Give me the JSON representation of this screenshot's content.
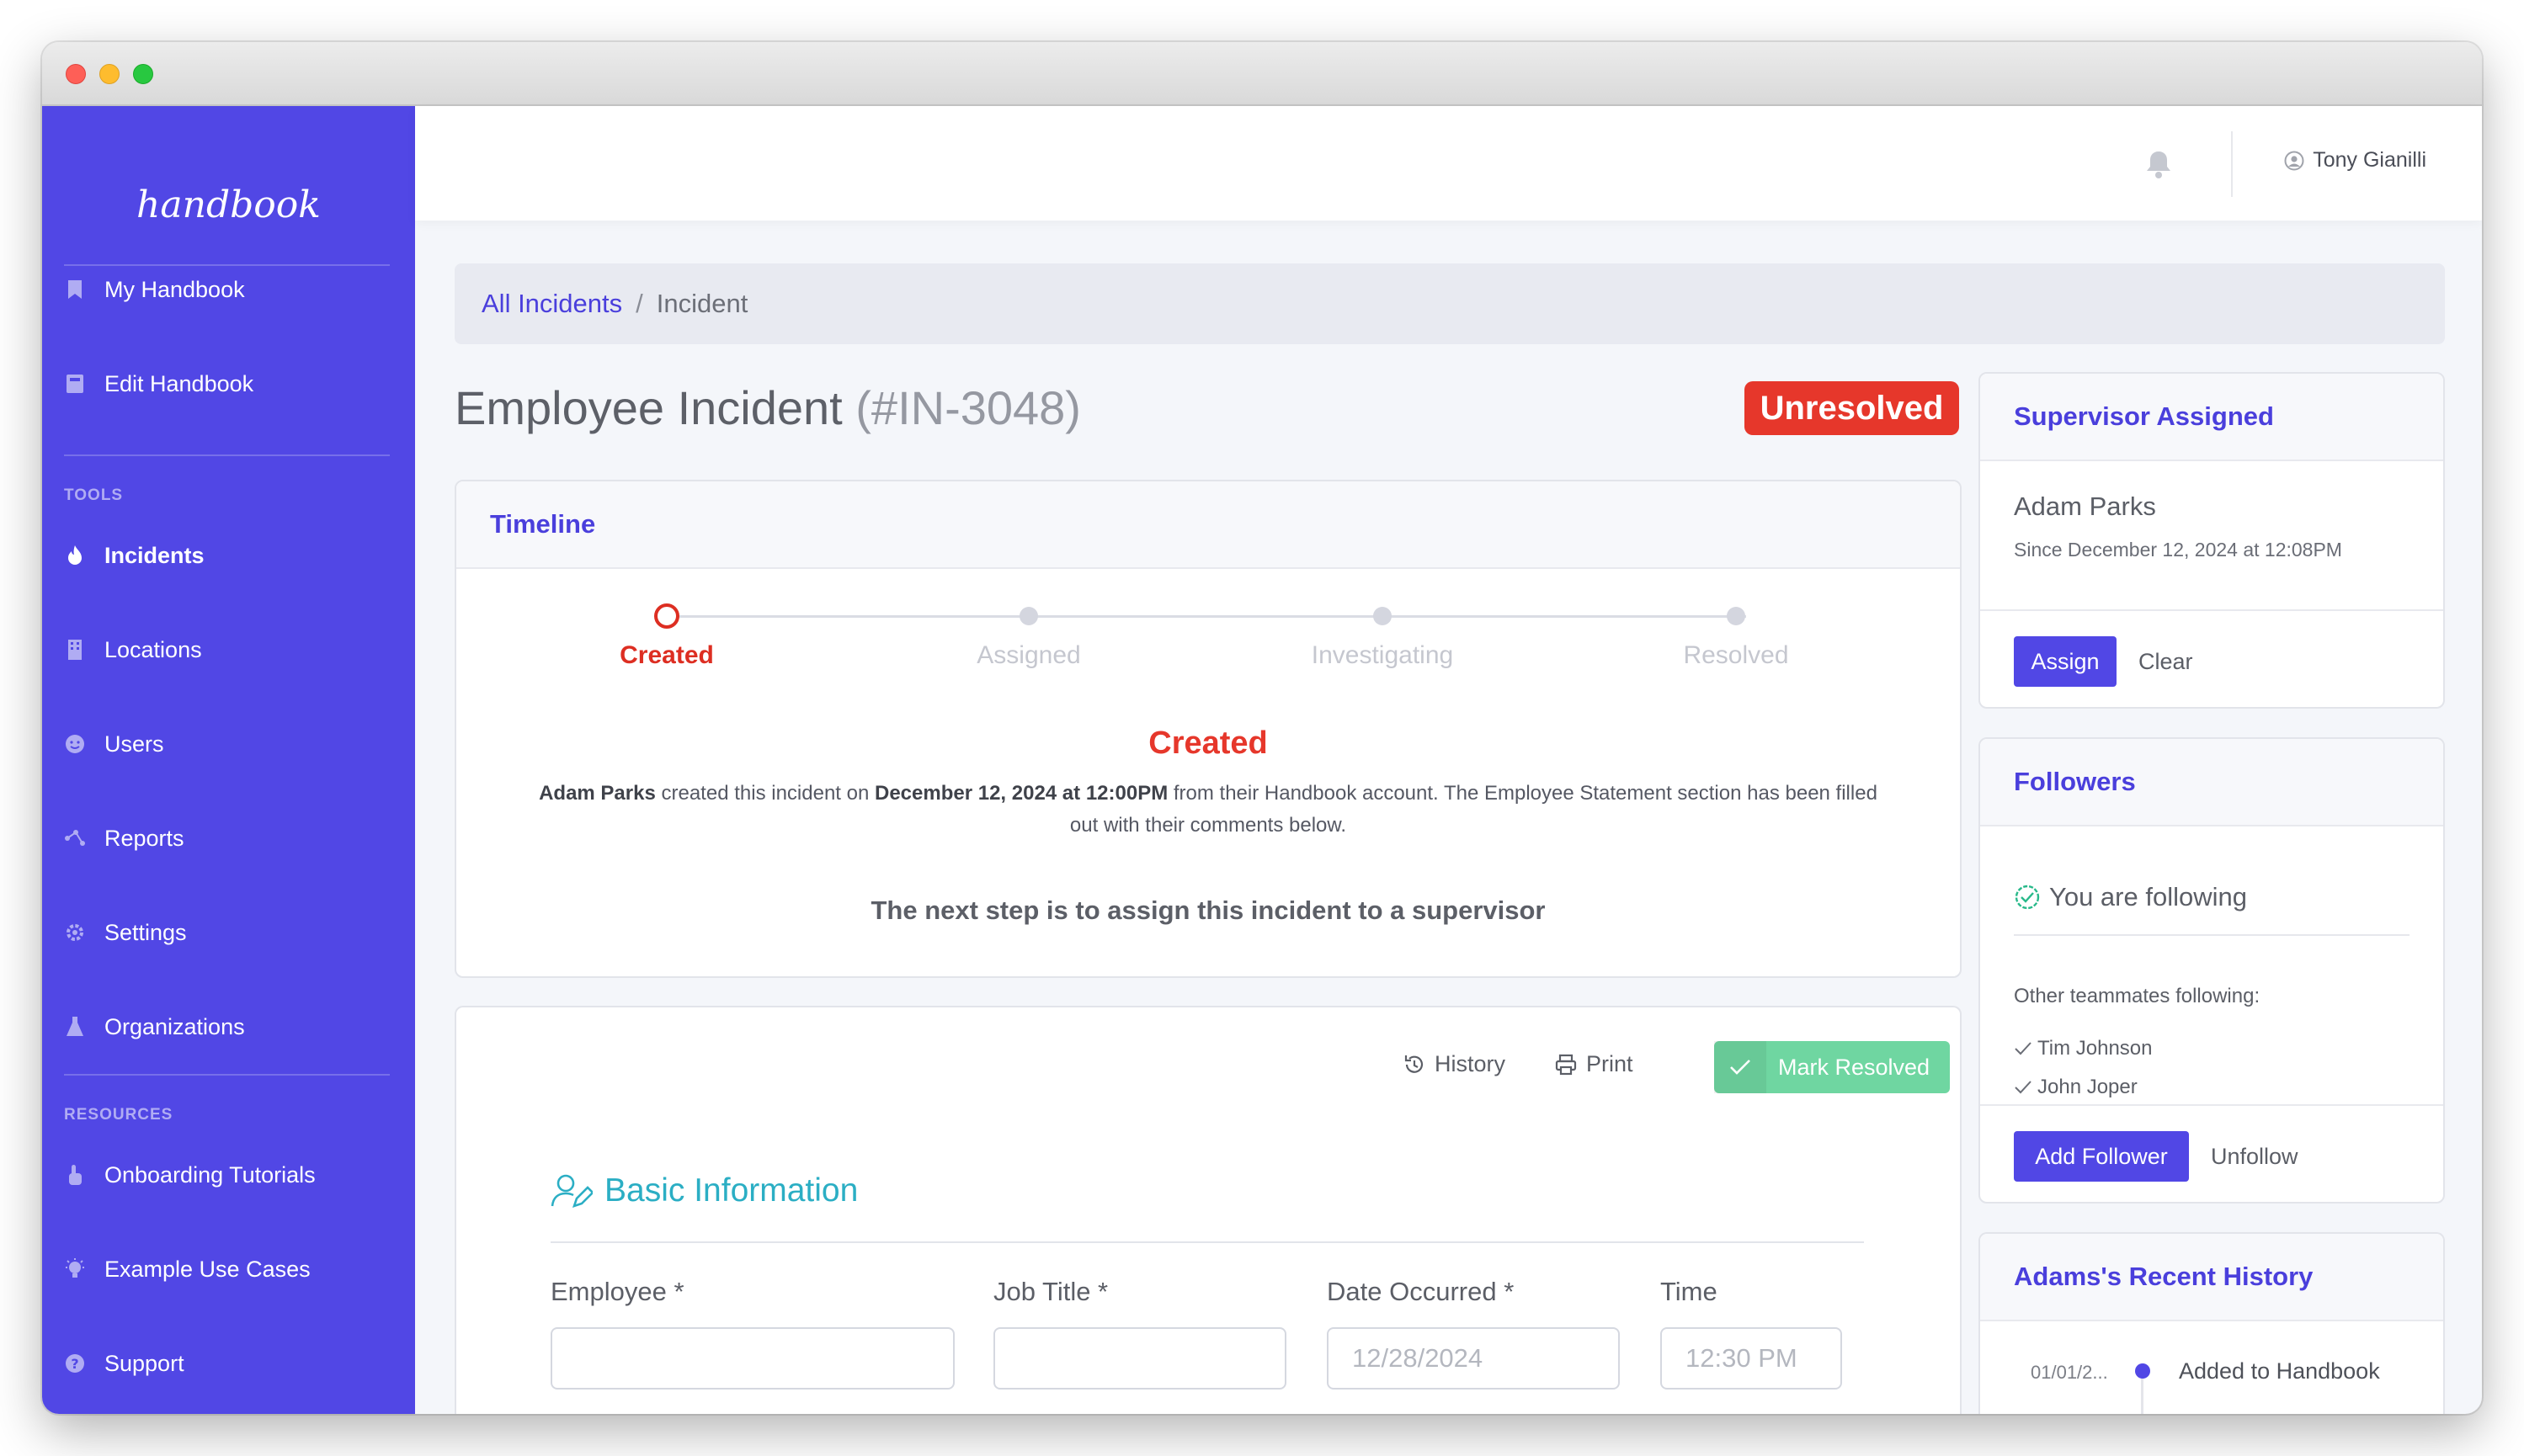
{
  "app": {
    "logo": "handbook",
    "user_name": "Tony Gianilli"
  },
  "sidebar": {
    "main_items": [
      {
        "label": "My Handbook",
        "icon": "bookmark-icon"
      },
      {
        "label": "Edit Handbook",
        "icon": "book-icon"
      }
    ],
    "tools_label": "TOOLS",
    "tools_items": [
      {
        "label": "Incidents",
        "icon": "flame-icon",
        "active": true
      },
      {
        "label": "Locations",
        "icon": "building-icon"
      },
      {
        "label": "Users",
        "icon": "smiley-icon"
      },
      {
        "label": "Reports",
        "icon": "network-icon"
      },
      {
        "label": "Settings",
        "icon": "gear-icon"
      },
      {
        "label": "Organizations",
        "icon": "flask-icon"
      }
    ],
    "resources_label": "RESOURCES",
    "resources_items": [
      {
        "label": "Onboarding Tutorials",
        "icon": "pointer-hand-icon"
      },
      {
        "label": "Example Use Cases",
        "icon": "lightbulb-icon"
      },
      {
        "label": "Support",
        "icon": "question-circle-icon"
      }
    ]
  },
  "breadcrumb": {
    "parent": "All Incidents",
    "separator": "/",
    "current": "Incident"
  },
  "incident": {
    "title": "Employee Incident",
    "number": "(#IN-3048)",
    "status": "Unresolved",
    "status_color": "#e6372b"
  },
  "timeline": {
    "title": "Timeline",
    "steps": [
      "Created",
      "Assigned",
      "Investigating",
      "Resolved"
    ],
    "current_step": "Created",
    "current_heading": "Created",
    "desc": {
      "actor": "Adam Parks",
      "text1": " created this incident on ",
      "date": "December 12, 2024 at 12:00PM",
      "text2": " from their Handbook account. The Employee Statement section has been filled out with their comments below."
    },
    "next_step": "The next step is to assign this incident to a supervisor"
  },
  "actions": {
    "history": "History",
    "print": "Print",
    "mark_resolved": "Mark Resolved"
  },
  "form": {
    "section_title": "Basic Information",
    "employee_label": "Employee *",
    "employee_value": "",
    "job_title_label": "Job Title *",
    "job_title_value": "",
    "date_label": "Date Occurred *",
    "date_value": "12/28/2024",
    "time_label": "Time",
    "time_value": "12:30 PM"
  },
  "supervisor": {
    "title": "Supervisor Assigned",
    "name": "Adam Parks",
    "since": "Since December 12, 2024 at 12:08PM",
    "assign_button": "Assign",
    "clear_button": "Clear"
  },
  "followers": {
    "title": "Followers",
    "status": "You are following",
    "others_label": "Other teammates following:",
    "others": [
      "Tim Johnson",
      "John Joper"
    ],
    "add_button": "Add Follower",
    "unfollow_button": "Unfollow"
  },
  "recent_history": {
    "title": "Adams's Recent History",
    "items": [
      {
        "date": "01/01/2...",
        "text": "Added to Handbook"
      }
    ]
  },
  "colors": {
    "sidebar": "#5147e5",
    "accent": "#4a3fdc",
    "danger": "#e6372b",
    "success": "#6fd6a1",
    "section_teal": "#2baec4"
  }
}
